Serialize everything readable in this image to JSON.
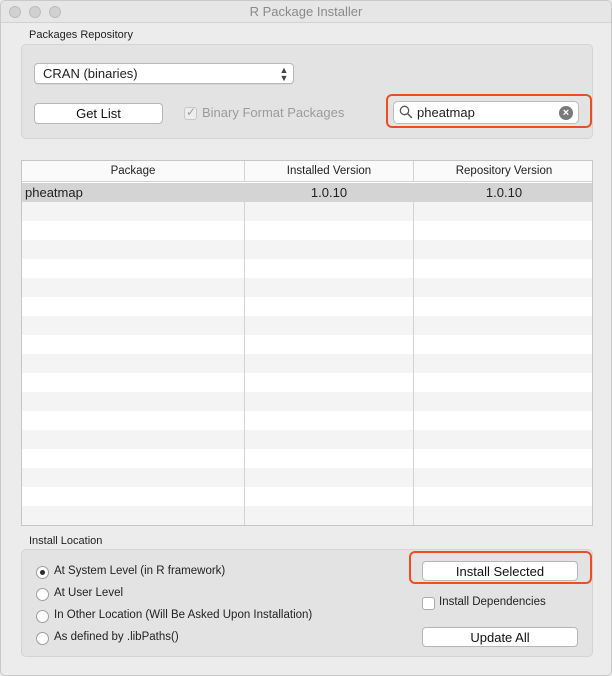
{
  "window": {
    "title": "R Package Installer"
  },
  "repository": {
    "group_label": "Packages Repository",
    "source_selected": "CRAN (binaries)",
    "get_list_label": "Get List",
    "binary_format_label": "Binary Format Packages",
    "binary_format_checked": true,
    "search_value": "pheatmap"
  },
  "table": {
    "columns": [
      "Package",
      "Installed Version",
      "Repository Version"
    ],
    "rows": [
      {
        "package": "pheatmap",
        "installed": "1.0.10",
        "repository": "1.0.10"
      }
    ]
  },
  "install": {
    "group_label": "Install Location",
    "options": [
      {
        "label": "At System Level (in R framework)",
        "selected": true
      },
      {
        "label": "At User Level",
        "selected": false
      },
      {
        "label": "In Other Location (Will Be Asked Upon Installation)",
        "selected": false
      },
      {
        "label": "As defined by .libPaths()",
        "selected": false
      }
    ],
    "install_selected_label": "Install Selected",
    "dependencies_label": "Install Dependencies",
    "dependencies_checked": false,
    "update_all_label": "Update All"
  },
  "colors": {
    "highlight": "#ee4e1f",
    "selection": "#d4d4d4"
  },
  "icons": [
    "search-icon",
    "clear-icon",
    "chevron-updown-icon",
    "checkmark-icon"
  ]
}
